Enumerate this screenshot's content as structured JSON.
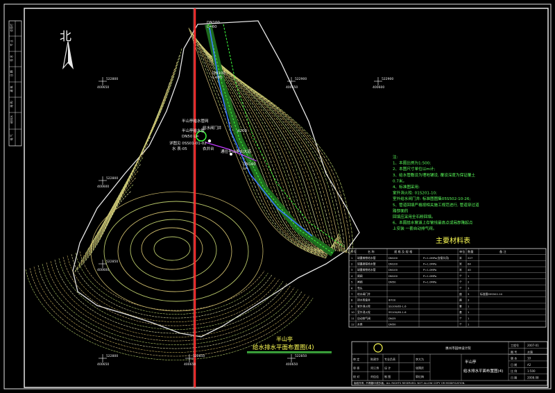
{
  "drawing": {
    "north_label": "北",
    "title_line1": "半山亭",
    "title_line2": "给水排水平面布置图(4)",
    "coord_labels": [
      {
        "a": "522800",
        "b": "400650"
      },
      {
        "a": "522800",
        "b": "400600"
      },
      {
        "a": "522900",
        "b": "400650"
      },
      {
        "a": "522900",
        "b": "400600"
      },
      {
        "a": "522850",
        "b": "400600"
      },
      {
        "a": "522850",
        "b": "400650"
      },
      {
        "a": "522800",
        "b": "400650"
      },
      {
        "a": "522850",
        "b": "400650"
      }
    ],
    "site_labels": {
      "pavilion": "半山亭给水管网",
      "valve": "给水阀门井",
      "pipe_note": "半山亭给水管",
      "pipe_size": "DN50 L=",
      "standard": "详图见 0SS01-01-02",
      "standard2": "水 表-05",
      "road": "衣井台",
      "road2": "通往半山亭山大道",
      "pipe_a": "DN100",
      "pipe_a2": "L=60",
      "pipe_b": "DN100",
      "pipe_b2": "L=80",
      "pipe_c": "DN100",
      "pipe_c2": "L=",
      "elev": "d200"
    },
    "notes": [
      "注:",
      "1、本图比例为1:500;",
      "2、本图尺寸单位以m计;",
      "3、给水管敷设为埋地铺设, 覆设深度为保证覆土",
      "   0.7米。",
      "4、标准图采用:",
      "   室外消火栓: 01S201-10;",
      "   室外给水阀门井: 标准图图集05S502-10-26;",
      "5、管道回填严格按相关施工规范进行, 管道穿过道",
      "   路部面的",
      "   回填应采用全石粉回填。",
      "6、本图给水管道上存管线最高点或局部隆起点",
      "   上安装    一套自动排气阀。"
    ],
    "materials_title": "主要材料表",
    "materials_headers": [
      "序号",
      "名 称",
      "规 格 及 规 格",
      "单位",
      "数量",
      "备 注"
    ],
    "materials_rows": [
      [
        "1",
        "球墨铸铁给水管",
        "DN100",
        "P=1.0MPa(含接头用)",
        "米",
        "227",
        ""
      ],
      [
        "2",
        "球墨铸铁给水管",
        "DN100",
        "P=1.0MPa",
        "米",
        "64",
        ""
      ],
      [
        "3",
        "球墨铸铁给水管",
        "DN100",
        "P=1.0MPa",
        "米",
        "40",
        ""
      ],
      [
        "4",
        "闸阀",
        "DN100",
        "P=1.0MPa",
        "个",
        "1",
        ""
      ],
      [
        "5",
        "闸阀",
        "DN50",
        "P=1.0MPa",
        "个",
        "2",
        ""
      ],
      [
        "6",
        "弯头",
        "",
        "",
        "个",
        "3",
        ""
      ],
      [
        "7",
        "给水阀门井",
        "",
        "",
        "座",
        "3",
        "标准图05S502-10"
      ],
      [
        "8",
        "排水检查井",
        "Φ700",
        "",
        "座",
        "3",
        ""
      ],
      [
        "9",
        "室外消火栓",
        "SS100/65-1.6",
        "",
        "套",
        "1",
        ""
      ],
      [
        "10",
        "室外消火栓",
        "SS100/65-1.6",
        "",
        "套",
        "1",
        ""
      ],
      [
        "11",
        "自动排气阀",
        "DN25",
        "",
        "个",
        "1",
        ""
      ],
      [
        "12",
        "水表",
        "DN50",
        "",
        "个",
        "1",
        ""
      ]
    ],
    "title_block": {
      "company": "惠州市园林设计院",
      "project": "半山亭",
      "sheet_title": "给水排水平面布置图(4)",
      "roles": [
        "审 定",
        "审 核",
        "校 对"
      ],
      "names": [
        "陈建华",
        "邓江涛",
        "刘佳佳"
      ],
      "roles2": [
        "专业负责",
        "设 计",
        "制 图"
      ],
      "names2": [
        "李大为",
        "张国庆",
        "郭红梅"
      ],
      "right_labels": [
        "工程号",
        "图 号",
        "版 本",
        "日 期"
      ],
      "right_values": [
        "2007-01",
        "水施",
        "10",
        "A2"
      ],
      "scale_label": "比 例",
      "scale_value": "1:500",
      "date_label": "日 期",
      "date_value": "2008.08",
      "copyright": "版权所有, 不得翻印或抄袭。ALL RIGHTS RESERVED. NOT ALLOW COPY OR MODIFICATION."
    },
    "left_strip": [
      "会签栏",
      "专 业",
      "签 名",
      "日 期",
      "建 筑",
      "结 构",
      "给排水",
      "电 气"
    ]
  }
}
